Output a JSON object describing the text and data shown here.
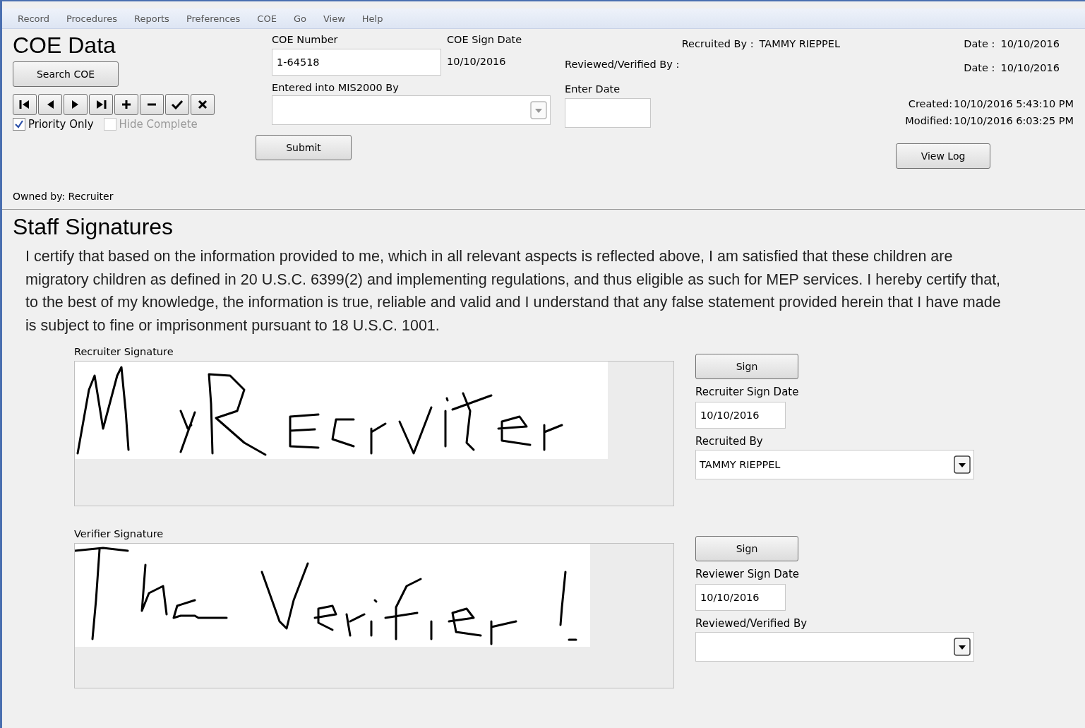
{
  "menu": [
    "Record",
    "Procedures",
    "Reports",
    "Preferences",
    "COE",
    "Go",
    "View",
    "Help"
  ],
  "header": {
    "title": "COE Data",
    "search_button": "Search COE",
    "nav_buttons": [
      {
        "kind": "first"
      },
      {
        "kind": "prev"
      },
      {
        "kind": "next"
      },
      {
        "kind": "last"
      },
      {
        "kind": "add"
      },
      {
        "kind": "remove"
      },
      {
        "kind": "confirm"
      },
      {
        "kind": "cancel"
      }
    ],
    "filters": [
      {
        "label": "Priority Only",
        "checked": true,
        "disabled": false
      },
      {
        "label": "Hide Complete",
        "checked": false,
        "disabled": true
      }
    ],
    "owned_by": "Owned by: Recruiter"
  },
  "coe_number": {
    "label": "COE Number",
    "value": "1-64518"
  },
  "coe_sign_date": {
    "label": "COE Sign Date",
    "value": "10/10/2016"
  },
  "entered_into": {
    "label": "Entered into MIS2000 By"
  },
  "submit_button": "Submit",
  "recruited_by": {
    "label": "Recruited By :",
    "value": "TAMMY RIEPPEL"
  },
  "reviewed_by": {
    "label": "Reviewed/Verified By :"
  },
  "enter_date": {
    "label": "Enter Date"
  },
  "dates": [
    {
      "label": "Date :",
      "value": "10/10/2016"
    },
    {
      "label": "Date :",
      "value": "10/10/2016"
    }
  ],
  "created": {
    "label": "Created:",
    "value": "10/10/2016 5:43:10 PM"
  },
  "modified": {
    "label": "Modified:",
    "value": "10/10/2016 6:03:25 PM"
  },
  "view_log_button": "View Log",
  "section_title": "Staff Signatures",
  "certification": "I certify that based on the information provided to me, which in all relevant aspects is reflected above, I am satisfied that these children are migratory children as defined in 20 U.S.C. 6399(2) and implementing regulations, and thus eligible as such for MEP services.  I hereby certify that, to the best of my knowledge, the information is true, reliable and valid and I understand that any false statement provided herein that I have made is subject to fine or imprisonment pursuant to 18 U.S.C. 1001.",
  "signatures": [
    {
      "kind": "recruiter",
      "label": "Recruiter Signature",
      "sign_button": "Sign",
      "date_label": "Recruiter Sign Date",
      "date_value": "10/10/2016",
      "by_label": "Recruited By",
      "by_value": "TAMMY RIEPPEL"
    },
    {
      "kind": "verifier",
      "label": "Verifier Signature",
      "sign_button": "Sign",
      "date_label": "Reviewer Sign Date",
      "date_value": "10/10/2016",
      "by_label": "Reviewed/Verified By"
    }
  ]
}
